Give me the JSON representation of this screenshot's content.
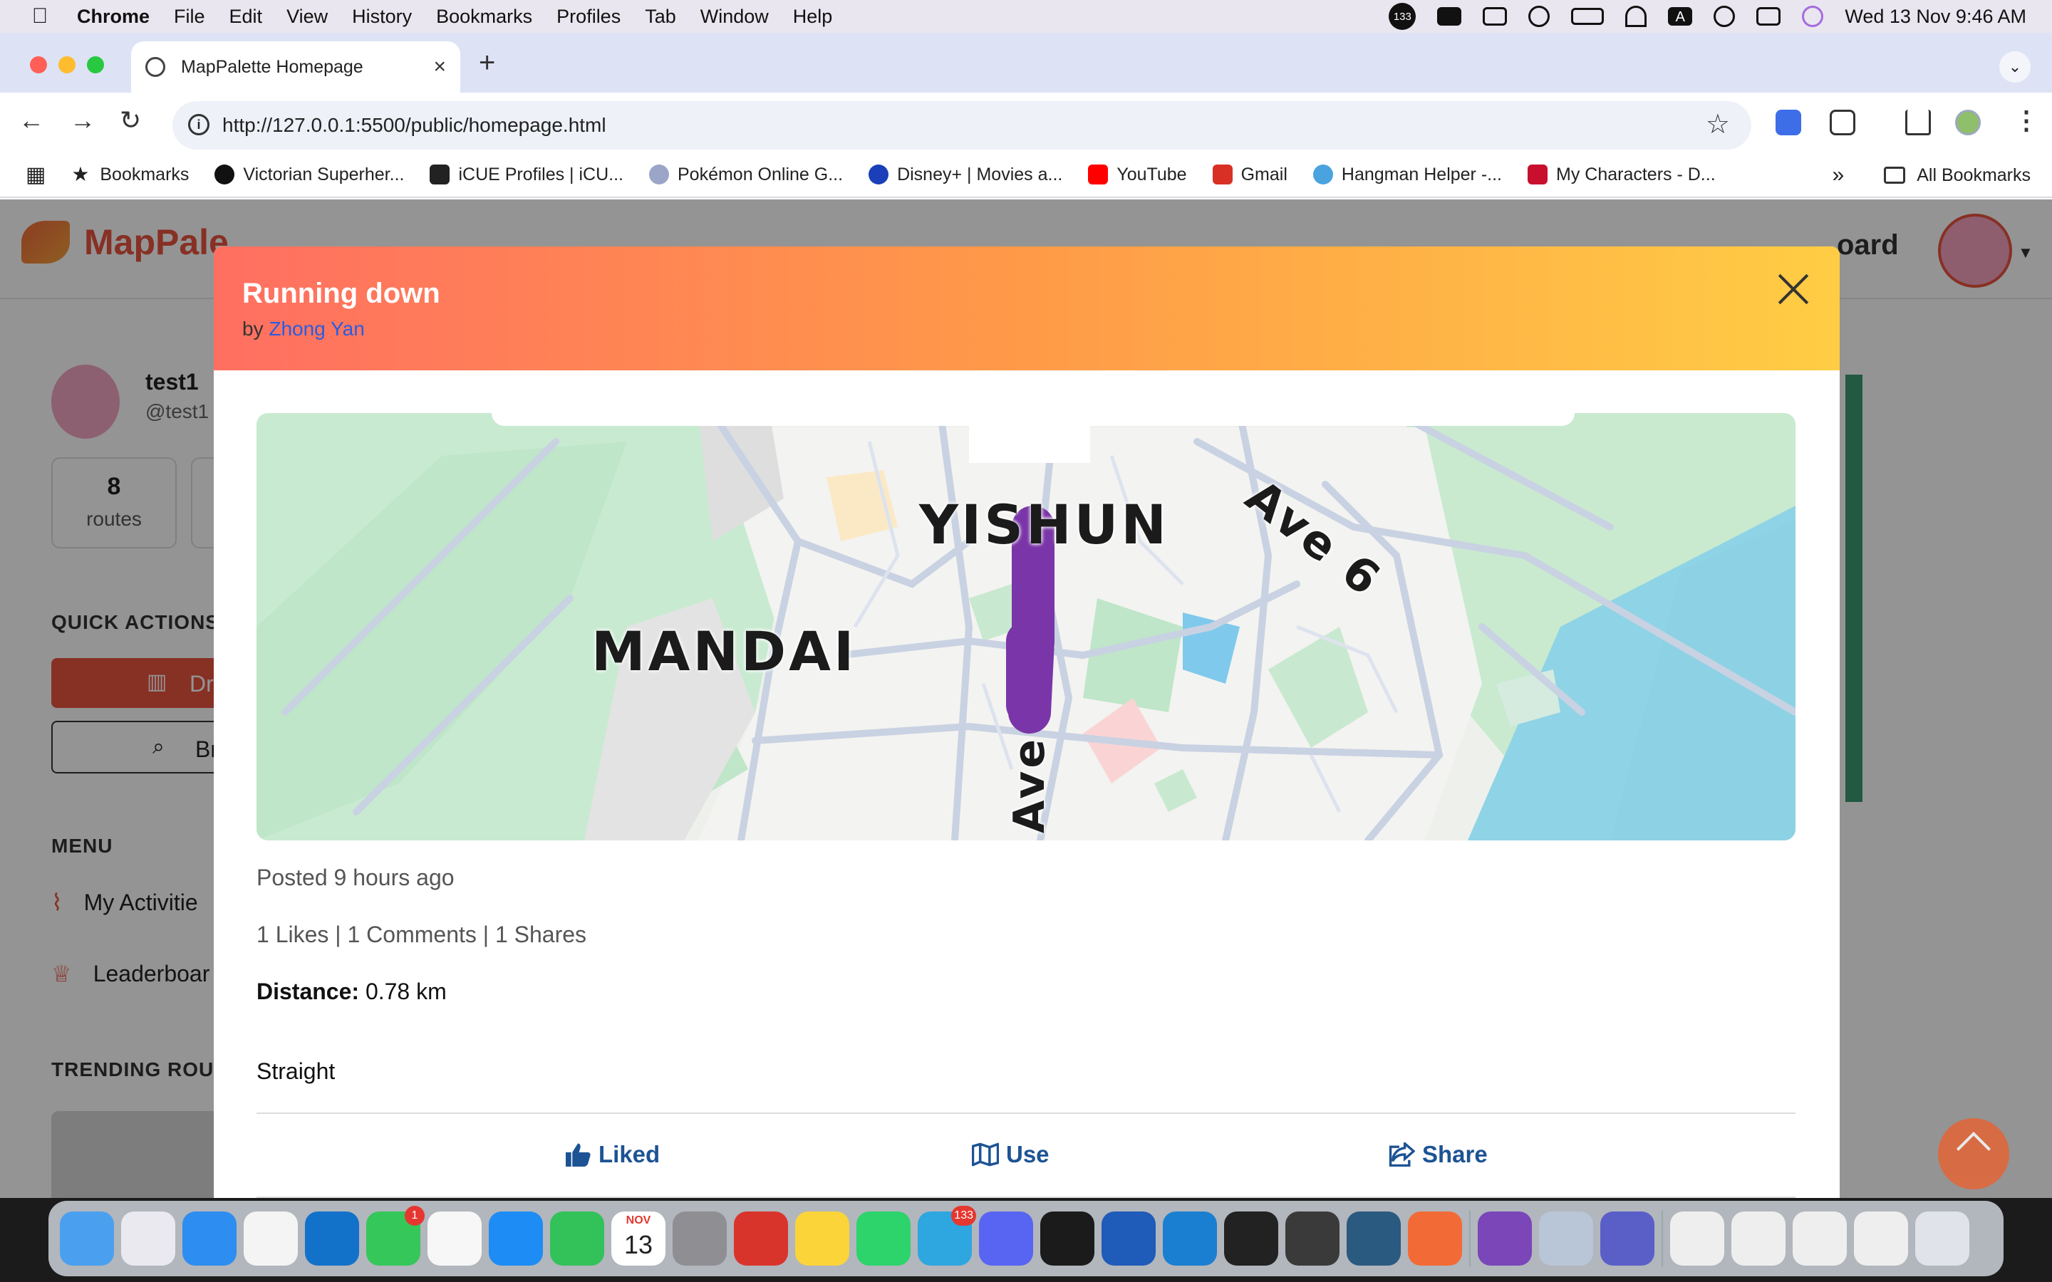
{
  "menubar": {
    "app_name": "Chrome",
    "items": [
      "File",
      "Edit",
      "View",
      "History",
      "Bookmarks",
      "Profiles",
      "Tab",
      "Window",
      "Help"
    ],
    "notification_count": "133",
    "datetime": "Wed 13 Nov  9:46 AM"
  },
  "browser": {
    "tab_title": "MapPalette Homepage",
    "url": "http://127.0.0.1:5500/public/homepage.html",
    "bookmarks": [
      {
        "label": "Bookmarks",
        "color": "#555555"
      },
      {
        "label": "Victorian Superher...",
        "color": "#111111"
      },
      {
        "label": "iCUE Profiles | iCU...",
        "color": "#222222"
      },
      {
        "label": "Pokémon Online G...",
        "color": "#9aa5c8"
      },
      {
        "label": "Disney+ | Movies a...",
        "color": "#1a3fb8"
      },
      {
        "label": "YouTube",
        "color": "#ff0000"
      },
      {
        "label": "Gmail",
        "color": "#d93025"
      },
      {
        "label": "Hangman Helper -...",
        "color": "#4aa3df"
      },
      {
        "label": "My Characters - D...",
        "color": "#c8102e"
      }
    ],
    "all_bookmarks": "All Bookmarks",
    "overflow": "»"
  },
  "app": {
    "logo": "MapPale",
    "nav_dashboard": "oard",
    "user": {
      "name": "test1",
      "handle": "@test1"
    },
    "stats": [
      {
        "value": "8",
        "label": "routes"
      }
    ],
    "quick_actions": "QUICK ACTIONS",
    "draw_btn": "Dr",
    "browse_btn": "Br",
    "menu_title": "MENU",
    "menu_items": [
      "My Activitie",
      "Leaderboar"
    ],
    "trending": "TRENDING ROUT"
  },
  "modal": {
    "title": "Running down",
    "by_label": "by",
    "author": "Zhong Yan",
    "map_labels": {
      "yishun": "YISHUN",
      "mandai": "MANDAI",
      "road": "Ave 6",
      "road2": "Ave"
    },
    "posted": "Posted 9 hours ago",
    "stats": "1 Likes | 1 Comments | 1 Shares",
    "distance_label": "Distance:",
    "distance_value": "0.78 km",
    "description": "Straight",
    "actions": {
      "like": "Liked",
      "use": "Use",
      "share": "Share"
    },
    "route_color": "#7a35a8"
  },
  "dock": {
    "apps": [
      {
        "name": "finder",
        "color": "#4aa0ef"
      },
      {
        "name": "launchpad",
        "color": "#e9e9ef"
      },
      {
        "name": "safari",
        "color": "#2e8df0"
      },
      {
        "name": "chrome",
        "color": "#f4f4f4"
      },
      {
        "name": "outlook",
        "color": "#1272c9"
      },
      {
        "name": "messages",
        "color": "#35c759",
        "badge": "1"
      },
      {
        "name": "photos",
        "color": "#f7f7f7"
      },
      {
        "name": "app-store",
        "color": "#1e8cf5"
      },
      {
        "name": "facetime",
        "color": "#33c15a"
      },
      {
        "name": "calendar",
        "color": "#ffffff",
        "label": "13",
        "month": "NOV"
      },
      {
        "name": "system-settings",
        "color": "#8e8e93"
      },
      {
        "name": "photo-booth",
        "color": "#d9342b"
      },
      {
        "name": "notes",
        "color": "#fbd43a"
      },
      {
        "name": "whatsapp",
        "color": "#2cd46b"
      },
      {
        "name": "telegram",
        "color": "#2ea6e0",
        "badge": "133"
      },
      {
        "name": "discord",
        "color": "#5865f2"
      },
      {
        "name": "spotify",
        "color": "#1b1b1b"
      },
      {
        "name": "word",
        "color": "#1f5bb8"
      },
      {
        "name": "vscode",
        "color": "#1a7fd1"
      },
      {
        "name": "terminal",
        "color": "#222222"
      },
      {
        "name": "tableplus",
        "color": "#3a3a3a"
      },
      {
        "name": "mysql-workbench",
        "color": "#2b5a80"
      },
      {
        "name": "swift-playgrounds",
        "color": "#f26b36"
      },
      {
        "name": "github-desktop",
        "color": "#7a46b8"
      },
      {
        "name": "preview",
        "color": "#b9c6d7"
      },
      {
        "name": "teams",
        "color": "#5a5fc8"
      },
      {
        "name": "window-1",
        "color": "#eeeeee"
      },
      {
        "name": "window-2",
        "color": "#eeeeee"
      },
      {
        "name": "window-3",
        "color": "#eeeeee"
      },
      {
        "name": "window-4",
        "color": "#eeeeee"
      },
      {
        "name": "trash",
        "color": "#e0e4ea"
      }
    ]
  }
}
